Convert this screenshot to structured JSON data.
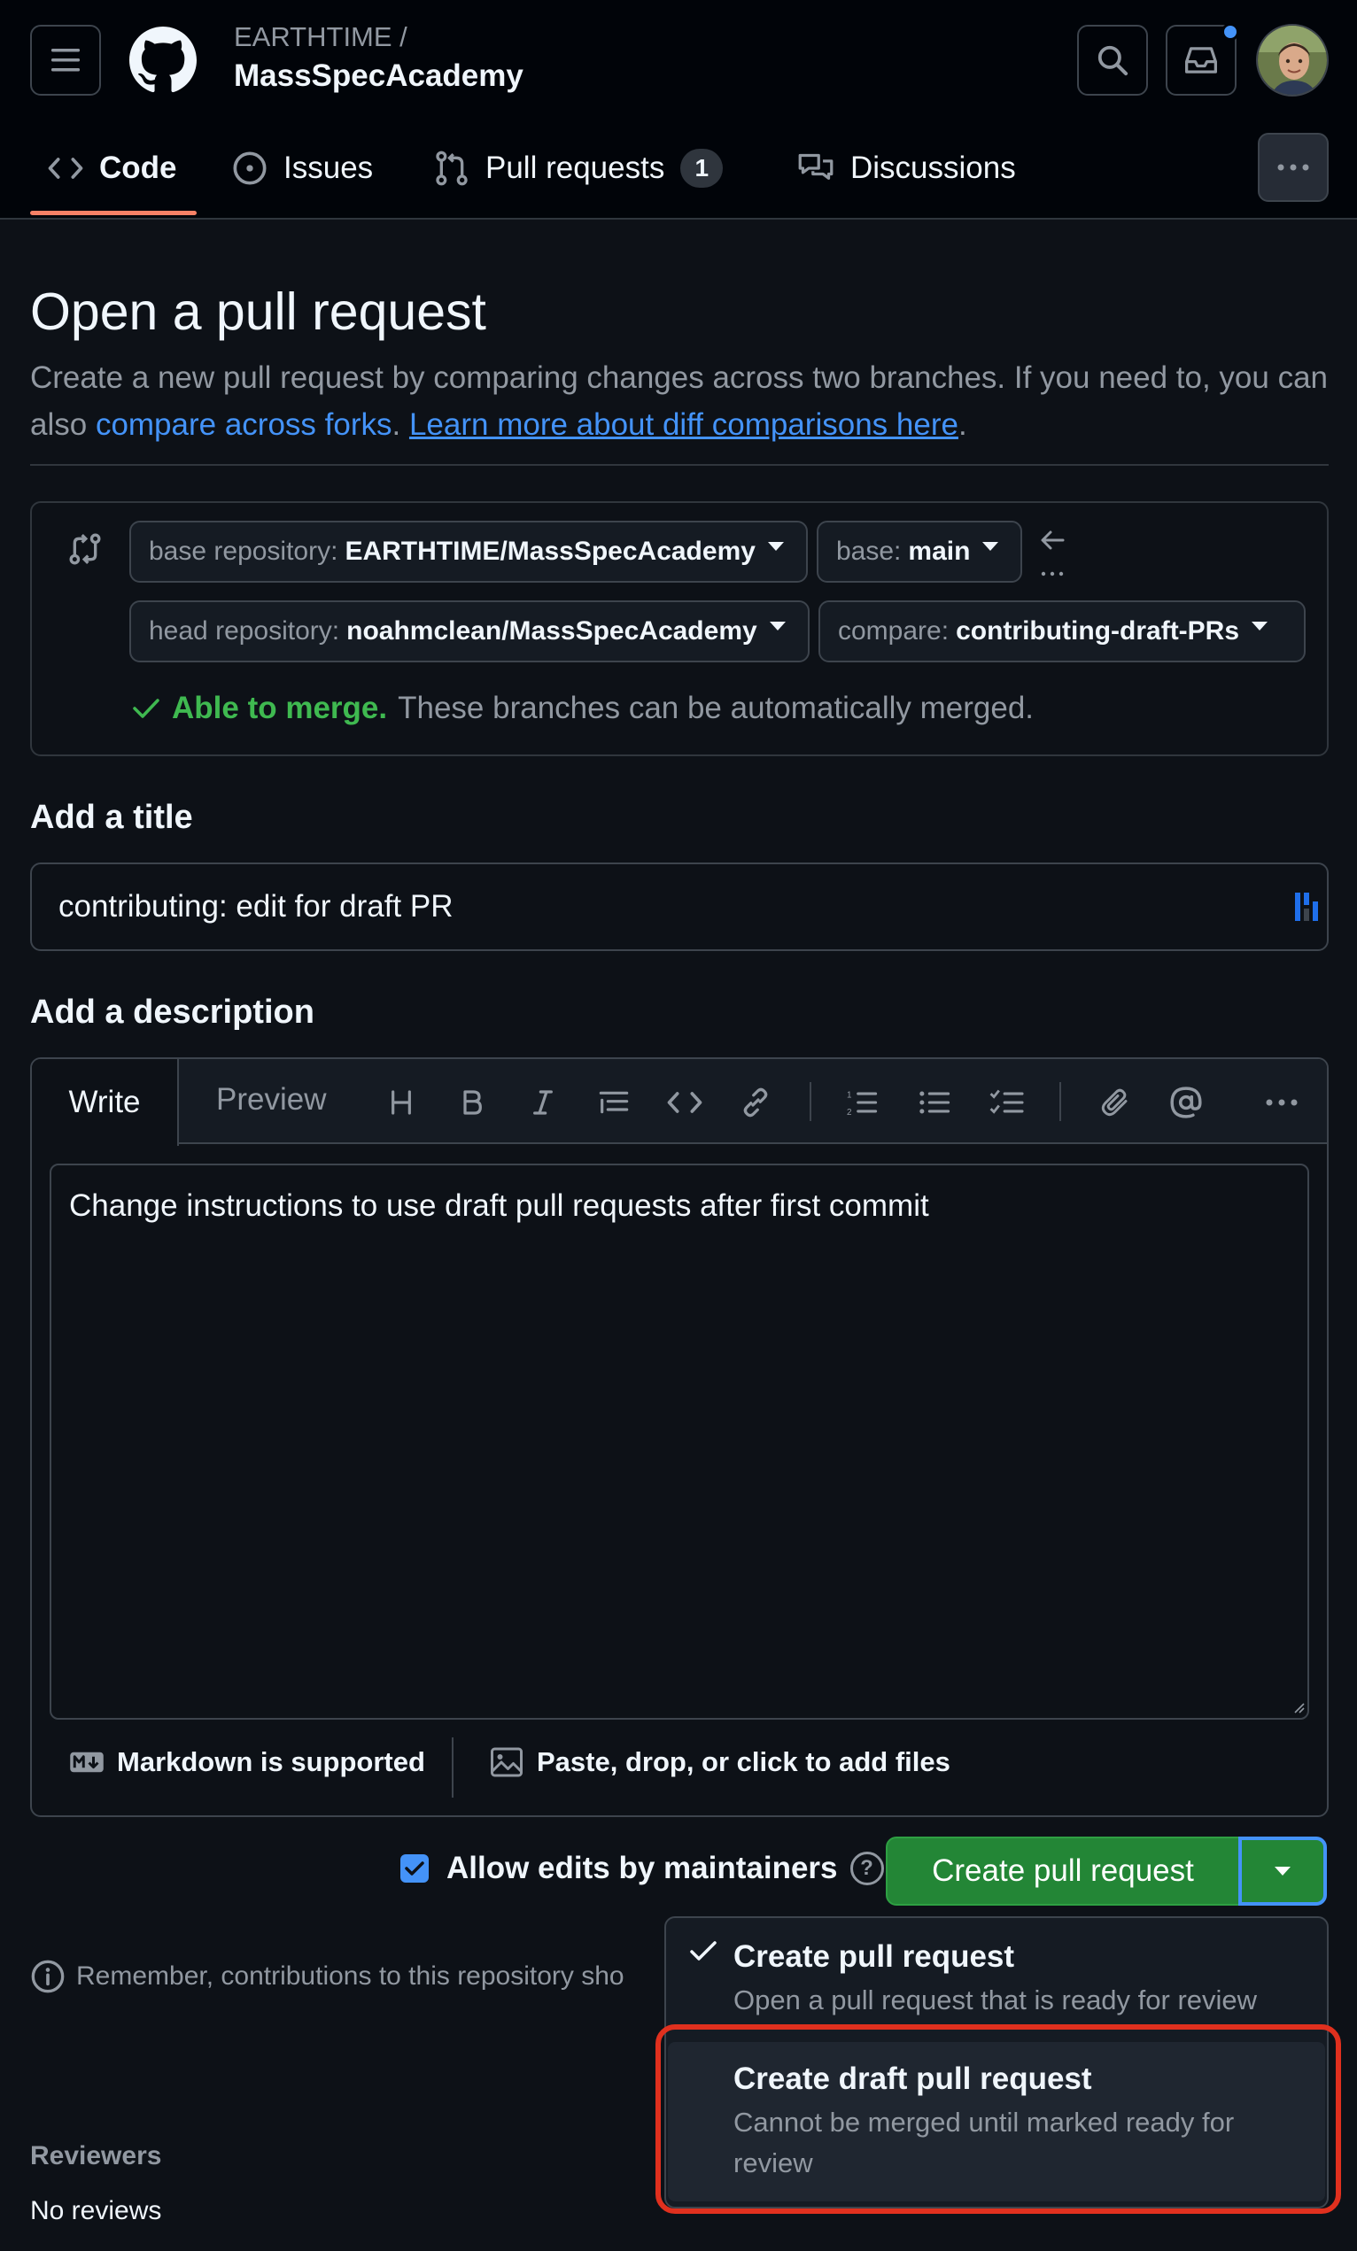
{
  "header": {
    "owner": "EARTHTIME /",
    "repo": "MassSpecAcademy"
  },
  "tabs": [
    {
      "label": "Code",
      "icon": "code-icon",
      "active": true
    },
    {
      "label": "Issues",
      "icon": "issue-opened-icon"
    },
    {
      "label": "Pull requests",
      "icon": "git-pull-request-icon",
      "count": "1"
    },
    {
      "label": "Discussions",
      "icon": "comment-discussion-icon"
    }
  ],
  "page": {
    "title": "Open a pull request",
    "desc_text": "Create a new pull request by comparing changes across two branches. If you need to, you can also ",
    "compare_forks_link": "compare across forks",
    "desc_sep": ". ",
    "learn_more_link": "Learn more about diff comparisons here",
    "desc_end": "."
  },
  "compare": {
    "base_repo_key": "base repository:",
    "base_repo_value": "EARTHTIME/MassSpecAcademy",
    "base_key": "base:",
    "base_value": "main",
    "head_repo_key": "head repository:",
    "head_repo_value": "noahmclean/MassSpecAcademy",
    "compare_key": "compare:",
    "compare_value": "contributing-draft-PRs",
    "merge_status": "Able to merge.",
    "merge_detail": "These branches can be automatically merged."
  },
  "title_section": {
    "label": "Add a title",
    "value": "contributing: edit for draft PR"
  },
  "description": {
    "label": "Add a description",
    "write_tab": "Write",
    "preview_tab": "Preview",
    "body": "Change instructions to use draft pull requests after first commit",
    "markdown_note": "Markdown is supported",
    "attach_note": "Paste, drop, or click to add files"
  },
  "actions": {
    "allow_edits": "Allow edits by maintainers",
    "create_button": "Create pull request",
    "remember": "Remember, contributions to this repository sho"
  },
  "menu": {
    "items": [
      {
        "title": "Create pull request",
        "desc": "Open a pull request that is ready for review",
        "checked": true
      },
      {
        "title": "Create draft pull request",
        "desc": "Cannot be merged until marked ready for review",
        "checked": false
      }
    ]
  },
  "sidebar": {
    "reviewers_heading": "Reviewers",
    "reviewers_value": "No reviews"
  },
  "colors": {
    "accent": "#4493f8",
    "success": "#238636",
    "highlight": "#e0301e",
    "tab_underline": "#f78166"
  }
}
